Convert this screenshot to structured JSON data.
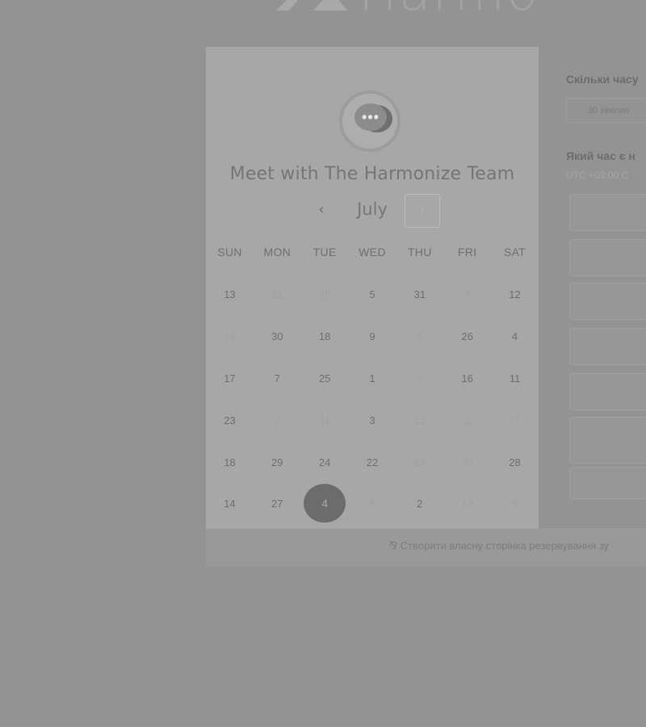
{
  "brand": {
    "name": "Harmo"
  },
  "profile": {
    "avatar_glyph": "•••"
  },
  "meeting": {
    "title": "Meet with The Harmonize Team"
  },
  "calendar": {
    "month": "July",
    "prev_label": "‹",
    "next_label": "›",
    "weekdays": [
      "SUN",
      "MON",
      "TUE",
      "WED",
      "THU",
      "FRI",
      "SAT"
    ],
    "weeks": [
      [
        {
          "d": "13",
          "a": true
        },
        {
          "d": "21",
          "a": false
        },
        {
          "d": "28",
          "a": false
        },
        {
          "d": "5",
          "a": true
        },
        {
          "d": "31",
          "a": true
        },
        {
          "d": "7",
          "a": false
        },
        {
          "d": "12",
          "a": true
        }
      ],
      [
        {
          "d": "19",
          "a": false
        },
        {
          "d": "30",
          "a": true
        },
        {
          "d": "18",
          "a": true
        },
        {
          "d": "9",
          "a": true
        },
        {
          "d": "6",
          "a": false
        },
        {
          "d": "26",
          "a": true
        },
        {
          "d": "4",
          "a": true
        }
      ],
      [
        {
          "d": "17",
          "a": true
        },
        {
          "d": "7",
          "a": true
        },
        {
          "d": "25",
          "a": true
        },
        {
          "d": "1",
          "a": true
        },
        {
          "d": "8",
          "a": false
        },
        {
          "d": "16",
          "a": true
        },
        {
          "d": "11",
          "a": true
        }
      ],
      [
        {
          "d": "23",
          "a": true
        },
        {
          "d": "2",
          "a": false
        },
        {
          "d": "31",
          "a": false
        },
        {
          "d": "3",
          "a": true
        },
        {
          "d": "12",
          "a": false
        },
        {
          "d": "22",
          "a": false
        },
        {
          "d": "27",
          "a": false
        }
      ],
      [
        {
          "d": "18",
          "a": true
        },
        {
          "d": "29",
          "a": true
        },
        {
          "d": "24",
          "a": true
        },
        {
          "d": "22",
          "a": true
        },
        {
          "d": "24",
          "a": false
        },
        {
          "d": "30",
          "a": false
        },
        {
          "d": "28",
          "a": true
        }
      ],
      [
        {
          "d": "14",
          "a": true
        },
        {
          "d": "27",
          "a": true
        },
        {
          "d": "4",
          "a": true,
          "sel": true
        },
        {
          "d": "8",
          "a": false
        },
        {
          "d": "2",
          "a": true
        },
        {
          "d": "19",
          "a": false
        },
        {
          "d": "9",
          "a": false
        }
      ]
    ]
  },
  "booking": {
    "duration_question": "Скільки часу",
    "duration_value": "30 хвилин",
    "time_question": "Який час є н",
    "timezone": "UTC +03:00 С"
  },
  "footer": {
    "icon": "⅋",
    "link": "Створити власну сторінка резервування зу"
  },
  "colors": {
    "overlay": "#939393",
    "panel": "#a7a7a7",
    "selected": "#6c6c6c"
  }
}
